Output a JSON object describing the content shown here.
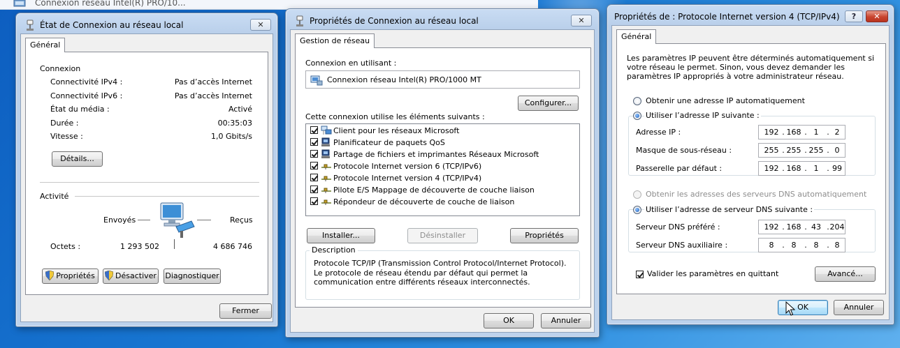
{
  "taskbar_behind": {
    "title": "Connexion réseau Intel(R) PRO/10..."
  },
  "status_window": {
    "title": "État de Connexion au réseau local",
    "close_label": "✕",
    "tab": "Général",
    "connection_section": "Connexion",
    "rows": [
      {
        "label": "Connectivité IPv4 :",
        "value": "Pas d’accès Internet"
      },
      {
        "label": "Connectivité IPv6 :",
        "value": "Pas d’accès Internet"
      },
      {
        "label": "État du média :",
        "value": "Activé"
      },
      {
        "label": "Durée :",
        "value": "00:35:03"
      },
      {
        "label": "Vitesse :",
        "value": "1,0 Gbits/s"
      }
    ],
    "details_button": "Détails...",
    "activity_section": "Activité",
    "sent_label": "Envoyés",
    "received_label": "Reçus",
    "bytes_label": "Octets :",
    "bytes_sent": "1 293 502",
    "bytes_received": "4 686 746",
    "properties_button": "Propriétés",
    "disable_button": "Désactiver",
    "diagnose_button": "Diagnostiquer",
    "close_button": "Fermer"
  },
  "props_window": {
    "title": "Propriétés de Connexion au réseau local",
    "close_label": "✕",
    "tab": "Gestion de réseau",
    "connect_using_label": "Connexion en utilisant :",
    "adapter_name": "Connexion réseau Intel(R) PRO/1000 MT",
    "configure_button": "Configurer...",
    "items_label": "Cette connexion utilise les éléments suivants :",
    "items": [
      {
        "label": "Client pour les réseaux Microsoft",
        "checked": true,
        "icon": "network-client-icon"
      },
      {
        "label": "Planificateur de paquets QoS",
        "checked": true,
        "icon": "network-service-icon"
      },
      {
        "label": "Partage de fichiers et imprimantes Réseaux Microsoft",
        "checked": true,
        "icon": "network-service-icon"
      },
      {
        "label": "Protocole Internet version 6 (TCP/IPv6)",
        "checked": true,
        "icon": "protocol-icon"
      },
      {
        "label": "Protocole Internet version 4 (TCP/IPv4)",
        "checked": true,
        "icon": "protocol-icon"
      },
      {
        "label": "Pilote E/S Mappage de découverte de couche liaison",
        "checked": true,
        "icon": "protocol-icon"
      },
      {
        "label": "Répondeur de découverte de couche de liaison",
        "checked": true,
        "icon": "protocol-icon"
      }
    ],
    "install_button": "Installer...",
    "uninstall_button": "Désinstaller",
    "properties_button": "Propriétés",
    "description_label": "Description",
    "description_text": "Protocole TCP/IP (Transmission Control Protocol/Internet Protocol). Le protocole de réseau étendu par défaut qui permet la communication entre différents réseaux interconnectés.",
    "ok_button": "OK",
    "cancel_button": "Annuler"
  },
  "ipv4_window": {
    "title": "Propriétés de : Protocole Internet version 4 (TCP/IPv4)",
    "help_label": "?",
    "close_label": "✕",
    "tab": "Général",
    "intro": "Les paramètres IP peuvent être déterminés automatiquement si votre réseau le permet. Sinon, vous devez demander les paramètres IP appropriés à votre administrateur réseau.",
    "auto_ip_label": "Obtenir une adresse IP automatiquement",
    "manual_ip_label": "Utiliser l’adresse IP suivante :",
    "ip_label": "Adresse IP :",
    "ip_value": [
      "192",
      "168",
      "1",
      "2"
    ],
    "mask_label": "Masque de sous-réseau :",
    "mask_value": [
      "255",
      "255",
      "255",
      "0"
    ],
    "gateway_label": "Passerelle par défaut :",
    "gateway_value": [
      "192",
      "168",
      "1",
      "99"
    ],
    "auto_dns_label": "Obtenir les adresses des serveurs DNS automatiquement",
    "manual_dns_label": "Utiliser l’adresse de serveur DNS suivante :",
    "dns1_label": "Serveur DNS préféré :",
    "dns1_value": [
      "192",
      "168",
      "43",
      "204"
    ],
    "dns2_label": "Serveur DNS auxiliaire :",
    "dns2_value": [
      "8",
      "8",
      "8",
      "8"
    ],
    "validate_label": "Valider les paramètres en quittant",
    "validate_checked": true,
    "advanced_button": "Avancé...",
    "ok_button": "OK",
    "cancel_button": "Annuler"
  }
}
